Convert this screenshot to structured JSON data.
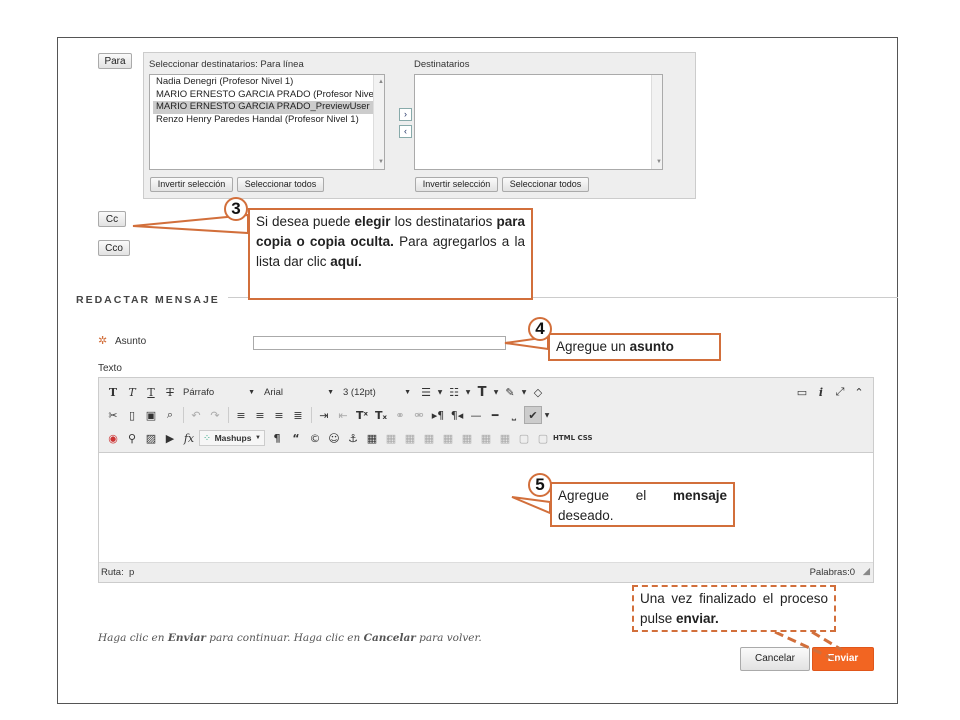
{
  "recipients": {
    "para_button": "Para",
    "select_label": "Seleccionar destinatarios: Para línea",
    "dest_label": "Destinatarios",
    "available": [
      "Nadia Denegri (Profesor Nivel 1)",
      "MARIO ERNESTO GARCIA PRADO (Profesor Nive",
      "MARIO ERNESTO GARCIA PRADO_PreviewUser",
      "Renzo Henry Paredes Handal (Profesor Nivel 1)"
    ],
    "selected_index": 2,
    "invert_label": "Invertir selección",
    "select_all_label": "Seleccionar todos",
    "move_right": "›",
    "move_left": "‹",
    "cc_button": "Cc",
    "cco_button": "Cco"
  },
  "compose": {
    "heading": "REDACTAR MENSAJE",
    "required_mark": "✲",
    "subject_label": "Asunto",
    "subject_value": "",
    "text_label": "Texto",
    "paragraph_select": "Párrafo",
    "font_select": "Arial",
    "size_select": "3 (12pt)",
    "mashups_label": "Mashups",
    "html_label": "HTML",
    "css_label": "CSS",
    "path_label": "Ruta:",
    "path_value": "p",
    "words_label": "Palabras:0"
  },
  "footer": {
    "instructions_parts": [
      "Haga clic en ",
      "Enviar",
      " para continuar. Haga clic en ",
      "Cancelar",
      " para volver."
    ],
    "cancel_button": "Cancelar",
    "send_button": "Enviar"
  },
  "callouts": {
    "c3": {
      "number": "3",
      "parts": [
        "Si desea puede ",
        "elegir",
        " los destinatarios ",
        "para copia o copia oculta.",
        " Para agregarlos a la lista dar clic ",
        "aquí."
      ]
    },
    "c4": {
      "number": "4",
      "parts": [
        "Agregue un ",
        "asunto"
      ]
    },
    "c5": {
      "number": "5",
      "parts": [
        "Agregue el ",
        "mensaje",
        " deseado."
      ]
    },
    "c6": {
      "parts": [
        "Una vez finalizado el proceso pulse ",
        "enviar."
      ]
    }
  },
  "colors": {
    "accent": "#d26f3b",
    "send": "#f26522"
  }
}
